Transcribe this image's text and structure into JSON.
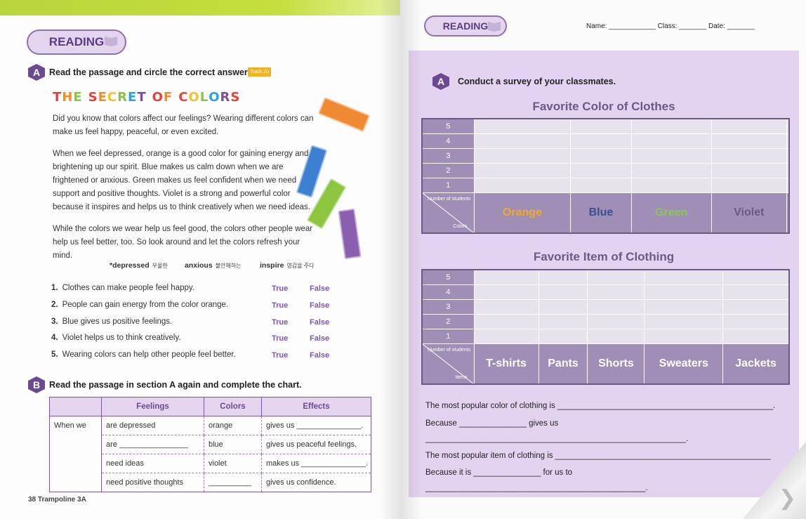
{
  "left": {
    "badge": "READING",
    "sectionA": {
      "letter": "A",
      "instruction": "Read the passage and circle the correct answers.",
      "track": "Track 20"
    },
    "title_letters": [
      {
        "ch": "T",
        "color": "#e83e3e"
      },
      {
        "ch": "H",
        "color": "#f28c28"
      },
      {
        "ch": "E",
        "color": "#8bc34a"
      },
      {
        "ch": " ",
        "color": "#000000"
      },
      {
        "ch": "S",
        "color": "#e83e3e"
      },
      {
        "ch": "E",
        "color": "#f28c28"
      },
      {
        "ch": "C",
        "color": "#f2c12e"
      },
      {
        "ch": "R",
        "color": "#8bc34a"
      },
      {
        "ch": "E",
        "color": "#29a3d8"
      },
      {
        "ch": "T",
        "color": "#7b4ea3"
      },
      {
        "ch": " ",
        "color": "#000000"
      },
      {
        "ch": "O",
        "color": "#e83e3e"
      },
      {
        "ch": "F",
        "color": "#f28c28"
      },
      {
        "ch": " ",
        "color": "#000000"
      },
      {
        "ch": "C",
        "color": "#e83e3e"
      },
      {
        "ch": "O",
        "color": "#f2c12e"
      },
      {
        "ch": "L",
        "color": "#8bc34a"
      },
      {
        "ch": "O",
        "color": "#29a3d8"
      },
      {
        "ch": "R",
        "color": "#7b4ea3"
      },
      {
        "ch": "S",
        "color": "#e83e3e"
      }
    ],
    "para1": "Did you know that colors affect our feelings? Wearing different colors can make us feel happy, peaceful, or even excited.",
    "para2": "When we feel depressed, orange is a good color for gaining energy and brightening up our spirit. Blue makes us calm down when we are frightened or anxious. Green makes us feel confident when we need support and positive thoughts. Violet is a strong and powerful color because it inspires and helps us to think creatively when we need ideas.",
    "para3": "While the colors we wear help us feel good, the colors other people wear help us feel better, too. So look around and let the colors refresh your mind.",
    "glossary": [
      {
        "word": "*depressed",
        "meaning": "우울한"
      },
      {
        "word": "anxious",
        "meaning": "불안해하는"
      },
      {
        "word": "inspire",
        "meaning": "영감을 주다"
      }
    ],
    "questions": [
      {
        "num": "1.",
        "text": "Clothes can make people feel happy."
      },
      {
        "num": "2.",
        "text": "People can gain energy from the color orange."
      },
      {
        "num": "3.",
        "text": "Blue gives us positive feelings."
      },
      {
        "num": "4.",
        "text": "Violet helps us to think creatively."
      },
      {
        "num": "5.",
        "text": "Wearing colors can help other people feel better."
      }
    ],
    "true_label": "True",
    "false_label": "False",
    "sectionB": {
      "letter": "B",
      "instruction": "Read the passage in section A again and complete the chart."
    },
    "chart": {
      "headers": [
        "",
        "Feelings",
        "Colors",
        "Effects"
      ],
      "row_label": "When we",
      "rows": [
        [
          "are depressed",
          "orange",
          "gives us _______________."
        ],
        [
          "are ________________",
          "blue",
          "gives us peaceful feelings."
        ],
        [
          "need ideas",
          "violet",
          "makes us _______________."
        ],
        [
          "need positive thoughts",
          "__________",
          "gives us confidence."
        ]
      ]
    },
    "footer": "38 Trampoline 3A"
  },
  "right": {
    "badge": "READING",
    "header": "Name: ____________ Class: _______ Date: _______",
    "sectionA": {
      "letter": "A",
      "instruction": "Conduct a survey of your classmates."
    },
    "chart1": {
      "title": "Favorite Color of Clothes",
      "y_values": [
        "5",
        "4",
        "3",
        "2",
        "1"
      ],
      "corner_top": "Number of students",
      "corner_bottom": "Colors",
      "categories": [
        {
          "label": "Orange",
          "color": "#f0a830"
        },
        {
          "label": "Blue",
          "color": "#3a4f8c"
        },
        {
          "label": "Green",
          "color": "#8fc25a"
        },
        {
          "label": "Violet",
          "color": "#6a5a84"
        },
        {
          "label": "",
          "color": "#ffffff"
        }
      ]
    },
    "chart2": {
      "title": "Favorite Item of Clothing",
      "y_values": [
        "5",
        "4",
        "3",
        "2",
        "1"
      ],
      "corner_top": "Number of students",
      "corner_bottom": "Items",
      "categories": [
        {
          "label": "T-shirts",
          "color": "#ffffff"
        },
        {
          "label": "Pants",
          "color": "#ffffff"
        },
        {
          "label": "Shorts",
          "color": "#ffffff"
        },
        {
          "label": "Sweaters",
          "color": "#ffffff"
        },
        {
          "label": "Jackets",
          "color": "#ffffff"
        }
      ]
    },
    "lines": [
      "The most popular color of clothing is ________________________________________________.",
      "Because _______________ gives us",
      "__________________________________________________________.",
      "The most popular item of clothing is ________________________________________________",
      "Because it is _______________ for us to",
      "_________________________________________________."
    ]
  }
}
